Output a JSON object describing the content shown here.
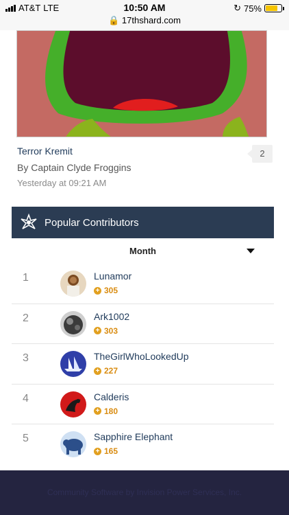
{
  "status_bar": {
    "carrier": "AT&T",
    "network": "LTE",
    "time": "10:50 AM",
    "url": "17thshard.com",
    "battery_percent_label": "75%",
    "battery_level": 0.75
  },
  "gallery_item": {
    "title": "Terror Kremit",
    "author_line": "By Captain Clyde Froggins",
    "timestamp": "Yesterday at 09:21 AM",
    "comment_count": "2"
  },
  "widget": {
    "title": "Popular Contributors",
    "filter": "Month"
  },
  "contributors": [
    {
      "rank": "1",
      "name": "Lunamor",
      "reputation": "305"
    },
    {
      "rank": "2",
      "name": "Ark1002",
      "reputation": "303"
    },
    {
      "rank": "3",
      "name": "TheGirlWhoLookedUp",
      "reputation": "227"
    },
    {
      "rank": "4",
      "name": "Calderis",
      "reputation": "180"
    },
    {
      "rank": "5",
      "name": "Sapphire Elephant",
      "reputation": "165"
    }
  ],
  "footer": {
    "text": "Community Software by Invision Power Services, Inc."
  },
  "colors": {
    "header_bg": "#2b3c53",
    "link": "#1f3a5a",
    "reputation": "#d98c11",
    "footer_bg": "#242440"
  }
}
